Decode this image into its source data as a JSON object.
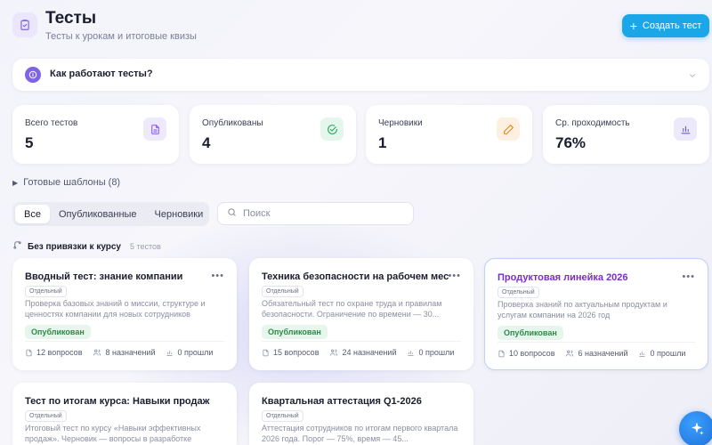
{
  "header": {
    "title": "Тесты",
    "subtitle": "Тесты к урокам и итоговые квизы",
    "create_label": "Создать тест",
    "icon": "clipboard-check-icon"
  },
  "how_it_works": {
    "label": "Как работают тесты?",
    "icon": "info-icon"
  },
  "stats": [
    {
      "label": "Всего тестов",
      "value": "5",
      "icon": "document-icon",
      "color": "#8b5cf6"
    },
    {
      "label": "Опубликованы",
      "value": "4",
      "icon": "check-circle-icon",
      "color": "#22a65a"
    },
    {
      "label": "Черновики",
      "value": "1",
      "icon": "pencil-icon",
      "color": "#e3861d"
    },
    {
      "label": "Ср. проходимость",
      "value": "76%",
      "icon": "bar-chart-icon",
      "color": "#6d5bd0"
    }
  ],
  "templates_label": "Готовые шаблоны (8)",
  "tabs": [
    {
      "label": "Все",
      "active": true
    },
    {
      "label": "Опубликованные",
      "active": false
    },
    {
      "label": "Черновики",
      "active": false
    }
  ],
  "search": {
    "placeholder": "Поиск"
  },
  "group": {
    "title": "Без привязки к курсу",
    "count": "5 тестов"
  },
  "cards": [
    {
      "title": "Вводный тест: знание компании",
      "tag": "Отдельный",
      "description": "Проверка базовых знаний о миссии, структуре и ценностях компании для новых сотрудников",
      "status": "Опубликован",
      "questions": "12 вопросов",
      "assignments": "8 назначений",
      "passed": "0 прошли"
    },
    {
      "title": "Техника безопасности на рабочем месте",
      "tag": "Отдельный",
      "description": "Обязательный тест по охране труда и правилам безопасности. Ограничение по времени — 30...",
      "status": "Опубликован",
      "questions": "15 вопросов",
      "assignments": "24 назначений",
      "passed": "0 прошли"
    },
    {
      "title": "Продуктовая линейка 2026",
      "tag": "Отдельный",
      "description": "Проверка знаний по актуальным продуктам и услугам компании на 2026 год",
      "status": "Опубликован",
      "questions": "10 вопросов",
      "assignments": "6 назначений",
      "passed": "0 прошли"
    },
    {
      "title": "Тест по итогам курса: Навыки продаж",
      "tag": "Отдельный",
      "description": "Итоговый тест по курсу «Навыки эффективных продаж». Черновик — вопросы в разработке"
    },
    {
      "title": "Квартальная аттестация Q1-2026",
      "tag": "Отдельный",
      "description": "Аттестация сотрудников по итогам первого квартала 2026 года. Порог — 75%, время — 45..."
    }
  ]
}
